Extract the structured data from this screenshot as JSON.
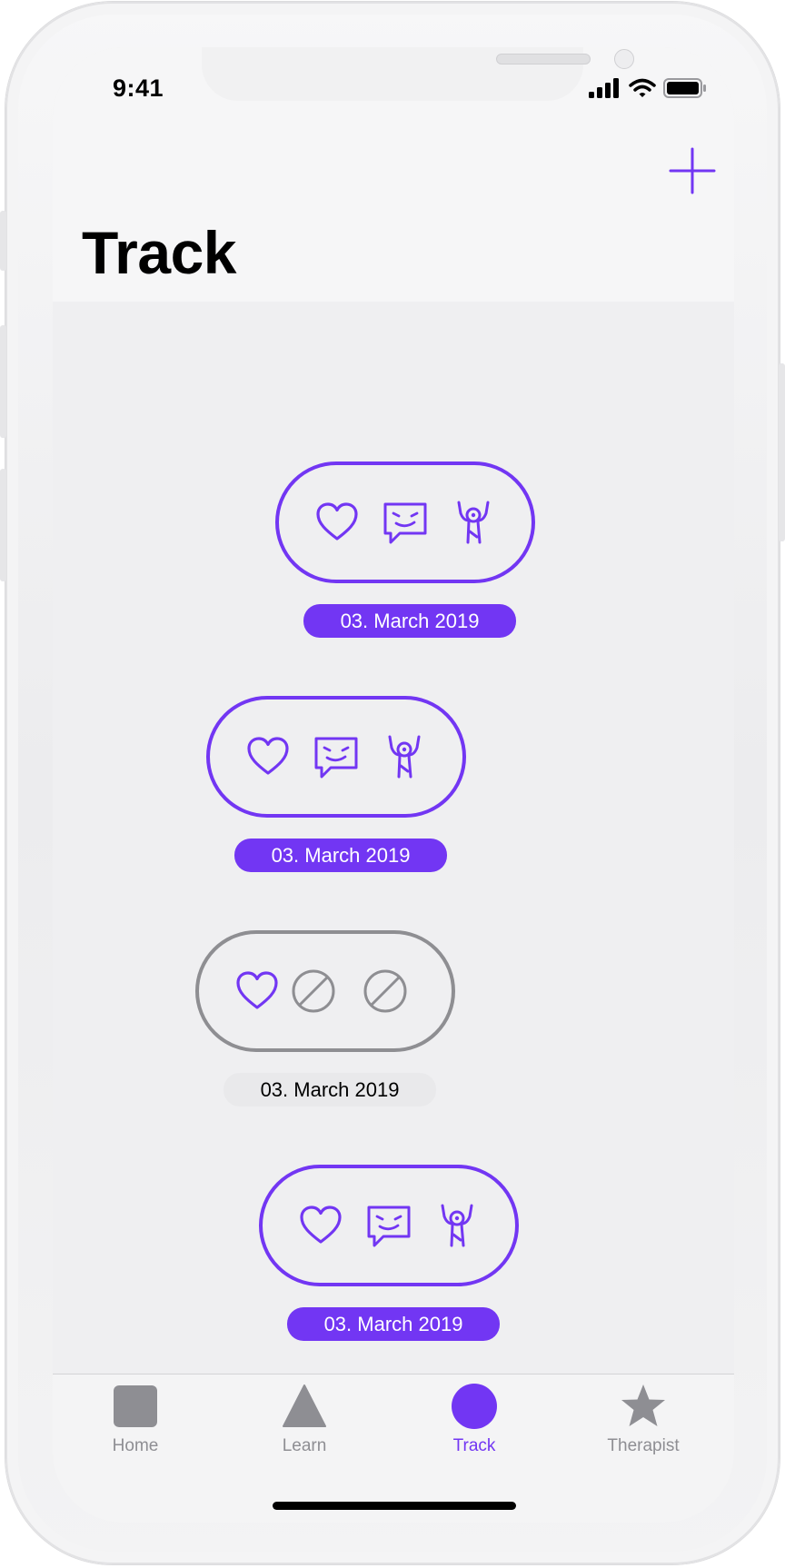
{
  "status_bar": {
    "time": "9:41"
  },
  "header": {
    "title": "Track"
  },
  "colors": {
    "accent": "#7236f3",
    "inactive": "#8e8e92"
  },
  "entries": [
    {
      "date": "03. March 2019",
      "state": "complete",
      "icons": [
        "heart-icon",
        "message-smile-icon",
        "person-arms-up-icon"
      ]
    },
    {
      "date": "03. March 2019",
      "state": "complete",
      "icons": [
        "heart-icon",
        "message-smile-icon",
        "person-arms-up-icon"
      ]
    },
    {
      "date": "03. March 2019",
      "state": "partial",
      "icons": [
        "heart-icon",
        "disabled-icon",
        "disabled-icon"
      ]
    },
    {
      "date": "03. March 2019",
      "state": "complete",
      "icons": [
        "heart-icon",
        "message-smile-icon",
        "person-arms-up-icon"
      ]
    }
  ],
  "tabbar": {
    "items": [
      {
        "label": "Home",
        "icon": "square-icon",
        "active": false
      },
      {
        "label": "Learn",
        "icon": "triangle-icon",
        "active": false
      },
      {
        "label": "Track",
        "icon": "circle-icon",
        "active": true
      },
      {
        "label": "Therapist",
        "icon": "star-icon",
        "active": false
      }
    ]
  }
}
